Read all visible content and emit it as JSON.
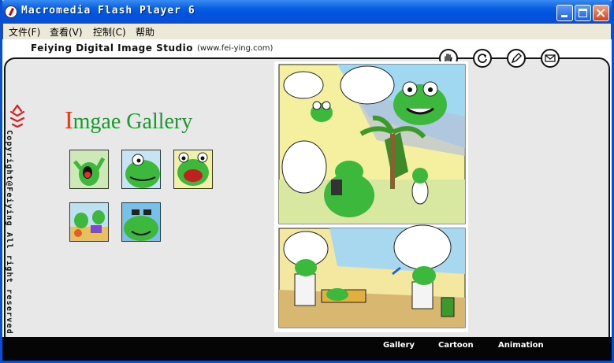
{
  "window": {
    "title": "Macromedia Flash Player 6"
  },
  "menu": {
    "items": [
      "文件(F)",
      "查看(V)",
      "控制(C)",
      "帮助"
    ]
  },
  "header": {
    "studio": "Feiying Digital Image Studio",
    "url": "(www.fei-ying.com)"
  },
  "toolbar_icons": [
    "hand-icon",
    "refresh-icon",
    "pen-icon",
    "mail-icon"
  ],
  "sidebar": {
    "copyright": "Copyright@Feiying All right reserved"
  },
  "gallery": {
    "title_first": "I",
    "title_rest": "mgae Gallery",
    "thumbnails": 5
  },
  "nav": {
    "gallery": "Gallery",
    "cartoon": "Cartoon",
    "animation": "Animation"
  },
  "colors": {
    "titlebar": "#0053e0",
    "panel": "#e8e8e8",
    "bottombar": "#050505",
    "gallery_title": "#1a9a2a",
    "gallery_initial": "#e03a1a",
    "frog_green": "#3cb83c"
  }
}
